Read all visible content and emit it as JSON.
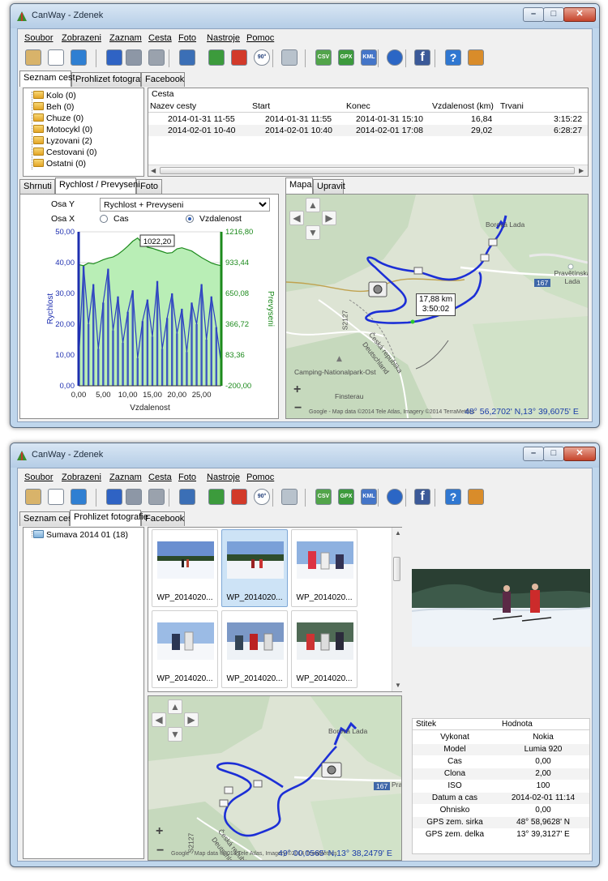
{
  "window": {
    "title": "CanWay - Zdenek",
    "controls": {
      "minimize": "–",
      "maximize": "□",
      "close": "✕"
    }
  },
  "menu": [
    "Soubor",
    "Zobrazeni",
    "Zaznam",
    "Cesta",
    "Foto",
    "Nastroje",
    "Pomoc"
  ],
  "toolbar": {
    "icons": [
      "map-icon",
      "chart-line-icon",
      "chart-bar-icon",
      "phone-icon",
      "database-upload-icon",
      "database-edit-icon",
      "import-icon",
      "add-image-icon",
      "delete-image-icon",
      "rotate-90-icon",
      "tools-icon",
      "export-csv-icon",
      "export-gpx-icon",
      "export-kml-icon",
      "google-earth-icon",
      "facebook-icon",
      "help-icon",
      "exit-icon"
    ],
    "rotate_label": "90°",
    "csv_label": "CSV",
    "gpx_label": "GPX",
    "kml_label": "KML"
  },
  "main_tabs": [
    "Seznam cest",
    "Prohlizet fotografie",
    "Facebook"
  ],
  "view1": {
    "active_tab": 0,
    "categories": [
      "Kolo (0)",
      "Beh (0)",
      "Chuze (0)",
      "Motocykl (0)",
      "Lyzovani (2)",
      "Cestovani (0)",
      "Ostatni (0)"
    ],
    "routes_title": "Cesta",
    "route_columns": [
      "Nazev cesty",
      "Start",
      "Konec",
      "Vzdalenost (km)",
      "Trvani"
    ],
    "routes": [
      {
        "name": "2014-01-31 11-55",
        "start": "2014-01-31 11:55",
        "end": "2014-01-31 15:10",
        "distance": "16,84",
        "duration": "3:15:22"
      },
      {
        "name": "2014-02-01 10-40",
        "start": "2014-02-01 10:40",
        "end": "2014-02-01 17:08",
        "distance": "29,02",
        "duration": "6:28:27"
      }
    ],
    "bottom_tabs": [
      "Shrnuti",
      "Rychlost / Prevyseni",
      "Foto"
    ],
    "osa_y_label": "Osa Y",
    "osa_y_value": "Rychlost + Prevyseni",
    "osa_x_label": "Osa X",
    "osa_x_options": [
      "Cas",
      "Vzdalenost"
    ],
    "osa_x_selected": "Vzdalenost",
    "map_tabs": [
      "Mapa",
      "Upravit"
    ],
    "map": {
      "tooltip_distance": "17,88 km",
      "tooltip_time": "3:50:02",
      "coord": "48° 56,2702' N,13° 39,6075' E",
      "credit": "Google - Map data ©2014 Tele Atlas, Imagery ©2014 TerraMetrics",
      "labels": [
        "Borová Lada",
        "Pravětínská Lada",
        "Camping-Nationalpark-Ost",
        "Finsterau",
        "Česká republika",
        "Deutschland",
        "167",
        "S2127"
      ],
      "zoom_in": "+",
      "zoom_out": "−"
    }
  },
  "chart_data": {
    "type": "line",
    "xlabel": "Vzdalenost",
    "ylabel": "Rychlost",
    "y2label": "Prevyseni",
    "xticks": [
      "0,00",
      "5,00",
      "10,00",
      "15,00",
      "20,00",
      "25,00"
    ],
    "xlim": [
      0,
      29.02
    ],
    "yticks": [
      "0,00",
      "10,00",
      "20,00",
      "30,00",
      "40,00",
      "50,00"
    ],
    "ylim": [
      0,
      50
    ],
    "y2ticks": [
      "-200,00",
      "83,36",
      "366,72",
      "650,08",
      "933,44",
      "1216,80"
    ],
    "y2lim": [
      -200,
      1216.8
    ],
    "tooltip": "1022,20",
    "series": [
      {
        "name": "Prevyseni",
        "axis": "right",
        "x": [
          0,
          1,
          2,
          3,
          4,
          5,
          6,
          7,
          8,
          9,
          10,
          11,
          12,
          13,
          14,
          15,
          16,
          17,
          18,
          19,
          20,
          21,
          22,
          23,
          24,
          25,
          26,
          27,
          28,
          29
        ],
        "values": [
          915,
          905,
          930,
          922,
          940,
          960,
          975,
          985,
          1010,
          1045,
          1085,
          1130,
          1160,
          1110,
          1075,
          1065,
          1050,
          1035,
          1020,
          1025,
          1060,
          1070,
          1055,
          1040,
          1010,
          980,
          955,
          930,
          915,
          905
        ]
      },
      {
        "name": "Rychlost",
        "axis": "left",
        "x": [
          0,
          1,
          2,
          3,
          4,
          5,
          6,
          7,
          8,
          9,
          10,
          11,
          12,
          13,
          14,
          15,
          16,
          17,
          18,
          19,
          20,
          21,
          22,
          23,
          24,
          25,
          26,
          27,
          28,
          29
        ],
        "values": [
          8,
          39,
          20,
          33,
          12,
          27,
          38,
          18,
          29,
          14,
          24,
          31,
          9,
          21,
          28,
          16,
          34,
          12,
          22,
          30,
          17,
          25,
          11,
          27,
          20,
          33,
          15,
          29,
          19,
          7
        ]
      }
    ]
  },
  "view2": {
    "active_tab": 1,
    "album": "Sumava 2014 01 (18)",
    "photos": [
      {
        "label": "WP_2014020...",
        "selected": false
      },
      {
        "label": "WP_2014020...",
        "selected": true
      },
      {
        "label": "WP_2014020...",
        "selected": false
      },
      {
        "label": "WP_2014020...",
        "selected": false
      },
      {
        "label": "WP_2014020...",
        "selected": false
      },
      {
        "label": "WP_2014020...",
        "selected": false
      }
    ],
    "map": {
      "coord": "49° 00,0565' N,13° 38,2479' E",
      "credit": "Google - Map data ©2014 Tele Atlas, Imagery ©2014 TerraMetrics",
      "labels": [
        "Borová Lada",
        "Pra",
        "Česká republika",
        "Deutschland",
        "167",
        "S2127"
      ],
      "zoom_in": "+",
      "zoom_out": "−"
    },
    "props_header": [
      "Stitek",
      "Hodnota"
    ],
    "props": [
      [
        "Vykonat",
        "Nokia"
      ],
      [
        "Model",
        "Lumia 920"
      ],
      [
        "Cas",
        "0,00"
      ],
      [
        "Clona",
        "2,00"
      ],
      [
        "ISO",
        "100"
      ],
      [
        "Datum a cas",
        "2014-02-01 11:14"
      ],
      [
        "Ohnisko",
        "0,00"
      ],
      [
        "GPS zem. sirka",
        "48° 58,9628' N"
      ],
      [
        "GPS zem. delka",
        "13° 39,3127' E"
      ]
    ]
  },
  "colors": {
    "speed": "#2a3ec2",
    "elevation_line": "#1c8a1c",
    "elevation_fill": "#b9eeb6",
    "track": "#1c2fd6",
    "coord_text": "#1a3ca8"
  }
}
